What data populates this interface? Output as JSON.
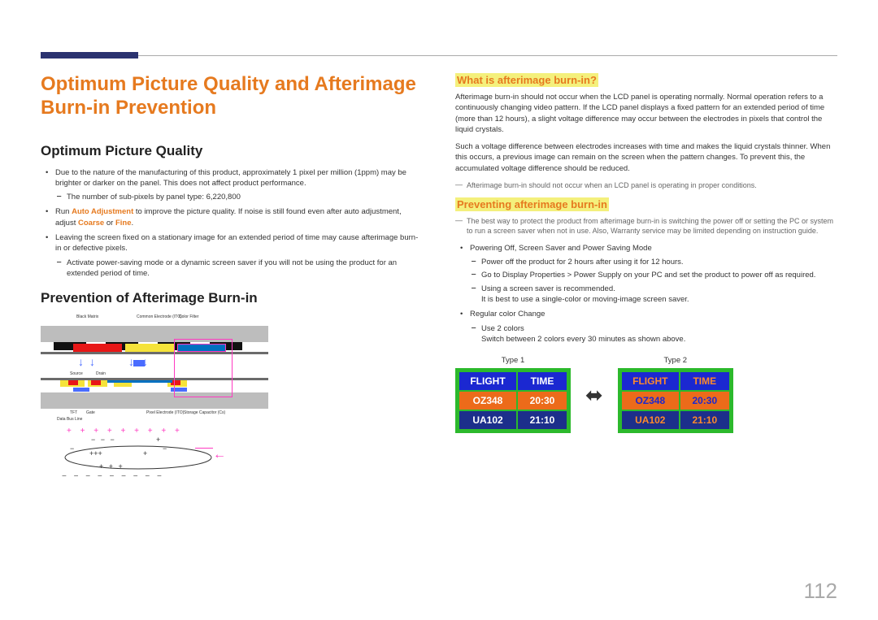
{
  "page_number": "112",
  "main_title": "Optimum Picture Quality and Afterimage Burn-in Prevention",
  "left": {
    "h2a": "Optimum Picture Quality",
    "opq": {
      "b1": "Due to the nature of the manufacturing of this product, approximately 1 pixel per million (1ppm) may be brighter or darker on the panel. This does not affect product performance.",
      "b1d1": "The number of sub-pixels by panel type: 6,220,800",
      "b2a": "Run ",
      "b2b": "Auto Adjustment",
      "b2c": " to improve the picture quality. If noise is still found even after auto adjustment, adjust ",
      "b2d": "Coarse",
      "b2e": " or ",
      "b2f": "Fine",
      "b2g": ".",
      "b3": "Leaving the screen fixed on a stationary image for an extended period of time may cause afterimage burn-in or defective pixels.",
      "b3d1": "Activate power-saving mode or a dynamic screen saver if you will not be using the product for an extended period of time."
    },
    "h2b": "Prevention of Afterimage Burn-in",
    "diagram": {
      "black_matrix": "Black Matrix",
      "common_electrode": "Common Electrode (ITO)",
      "color_filter": "Color Filter",
      "source": "Source",
      "drain": "Drain",
      "tft": "TFT",
      "gate": "Gate",
      "data_bus_line": "Data Bus Line",
      "pixel_electrode": "Pixel Electrode (ITO)",
      "storage_cap": "Storage Capacitor (Cs)"
    }
  },
  "right": {
    "h3a": "What is afterimage burn-in?",
    "p1": "Afterimage burn-in should not occur when the LCD panel is operating normally. Normal operation refers to a continuously changing video pattern. If the LCD panel displays a fixed pattern for an extended period of time (more than 12 hours), a slight voltage difference may occur between the electrodes in pixels that control the liquid crystals.",
    "p2": "Such a voltage difference between electrodes increases with time and makes the liquid crystals thinner. When this occurs, a previous image can remain on the screen when the pattern changes. To prevent this, the accumulated voltage difference should be reduced.",
    "note1": "Afterimage burn-in should not occur when an LCD panel is operating in proper conditions.",
    "h3b": "Preventing afterimage burn-in",
    "note2": "The best way to protect the product from afterimage burn-in is switching the power off or setting the PC or system to run a screen saver when not in use. Also, Warranty service may be limited depending on instruction guide.",
    "b1": "Powering Off, Screen Saver and Power Saving Mode",
    "b1d1": "Power off the product for 2 hours after using it for 12 hours.",
    "b1d2": "Go to Display Properties > Power Supply on your PC and set the product to power off as required.",
    "b1d3": "Using a screen saver is recommended.",
    "b1d3s": "It is best to use a single-color or moving-image screen saver.",
    "b2": "Regular color Change",
    "b2d1": "Use 2 colors",
    "b2d1s": "Switch between 2 colors every 30 minutes as shown above.",
    "table": {
      "type1": "Type 1",
      "type2": "Type 2",
      "h_flight": "FLIGHT",
      "h_time": "TIME",
      "r1a": "OZ348",
      "r1b": "20:30",
      "r2a": "UA102",
      "r2b": "21:10"
    }
  }
}
